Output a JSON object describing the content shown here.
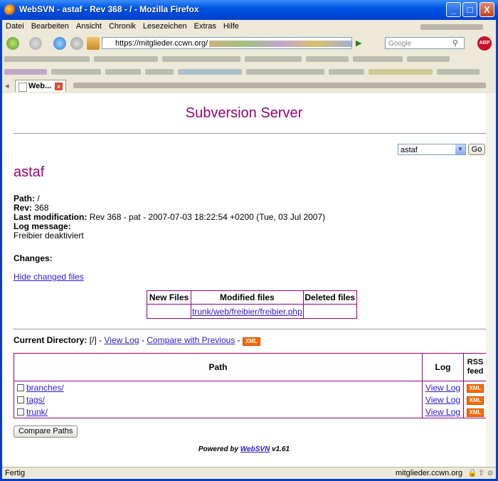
{
  "window": {
    "title": "WebSVN - astaf - Rev 368 - / - Mozilla Firefox",
    "minimize": "_",
    "maximize": "□",
    "close": "X"
  },
  "menu": [
    "Datei",
    "Bearbeiten",
    "Ansicht",
    "Chronik",
    "Lesezeichen",
    "Extras",
    "Hilfe"
  ],
  "nav": {
    "url": "https://mitglieder.ccwn.org/",
    "search_placeholder": "Google",
    "abp": "ABP"
  },
  "tabs": {
    "active_label": "Web...",
    "close": "x"
  },
  "page": {
    "header": "Subversion Server",
    "repo_select_value": "astaf",
    "go_button": "Go",
    "repo_name": "astaf",
    "path_label": "Path:",
    "path_value": "/",
    "rev_label": "Rev:",
    "rev_value": "368",
    "lastmod_label": "Last modification:",
    "lastmod_value": "Rev 368 - pat - 2007-07-03 18:22:54 +0200 (Tue, 03 Jul 2007)",
    "logmsg_label": "Log message:",
    "logmsg_value": "Freibier deaktiviert",
    "changes_label": "Changes:",
    "hide_changed": "Hide changed files",
    "changes_table": {
      "headers": [
        "New Files",
        "Modified files",
        "Deleted files"
      ],
      "modified": "trunk/web/freibier/freibier.php"
    },
    "curdir": {
      "label": "Current Directory:",
      "value": "[/]",
      "sep1": "-",
      "view_log": "View Log",
      "sep2": "-",
      "compare": "Compare with Previous",
      "sep3": "-",
      "xml": "XML"
    },
    "dir_table": {
      "col_path": "Path",
      "col_log": "Log",
      "col_rss": "RSS feed",
      "rows": [
        {
          "name": "branches/",
          "log": "View Log",
          "rss": "XML"
        },
        {
          "name": "tags/",
          "log": "View Log",
          "rss": "XML"
        },
        {
          "name": "trunk/",
          "log": "View Log",
          "rss": "XML"
        }
      ]
    },
    "compare_paths": "Compare Paths",
    "footer_prefix": "Powered by",
    "footer_link": "WebSVN",
    "footer_version": "v1.61"
  },
  "status": {
    "left": "Fertig",
    "right": "mitglieder.ccwn.org"
  }
}
